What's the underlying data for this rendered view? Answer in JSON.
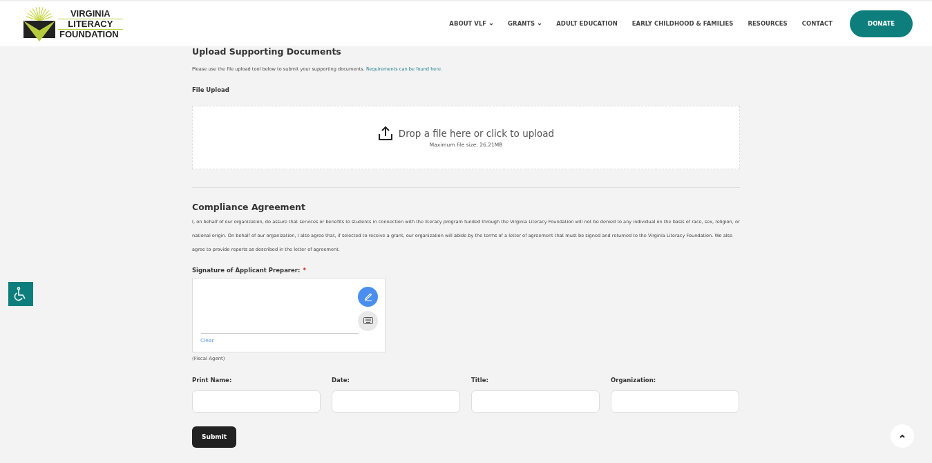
{
  "header": {
    "logo_lines": [
      "VIRGINIA",
      "LITERACY",
      "FOUNDATION"
    ],
    "nav": [
      {
        "label": "ABOUT VLF",
        "has_menu": true
      },
      {
        "label": "GRANTS",
        "has_menu": true
      },
      {
        "label": "ADULT EDUCATION",
        "has_menu": false
      },
      {
        "label": "EARLY CHILDHOOD & FAMILIES",
        "has_menu": false
      },
      {
        "label": "RESOURCES",
        "has_menu": false
      },
      {
        "label": "CONTACT",
        "has_menu": false
      }
    ],
    "donate": "DONATE"
  },
  "upload_section": {
    "title": "Upload Supporting Documents",
    "intro": "Please use the file upload tool below to submit your supporting documents.",
    "link": "Requirements can be found here.",
    "field_label": "File Upload",
    "drop_text": "Drop a file here or click to upload",
    "max_size": "Maximum file size: 26.21MB"
  },
  "compliance": {
    "title": "Compliance Agreement",
    "text": "I, on behalf of our organization, do assure that services or benefits to students in connection with the literacy program funded through the Virginia Literacy Foundation will not be denied to any individual on the basis of race, sex, religion, or national origin. On behalf of our organization, I also agree that, if selected to receive a grant, our organization will abide by the terms of a letter of agreement that must be signed and returned to the Virginia Literacy Foundation. We also agree to provide reports as described in the letter of agreement.",
    "signature": {
      "label": "Signature of Applicant Preparer:",
      "required": true,
      "required_mark": "*",
      "clear": "Clear",
      "note": "(Fiscal Agent)"
    },
    "fields": [
      {
        "label": "Print Name:"
      },
      {
        "label": "Date:"
      },
      {
        "label": "Title:"
      },
      {
        "label": "Organization:"
      }
    ],
    "submit": "Submit"
  }
}
